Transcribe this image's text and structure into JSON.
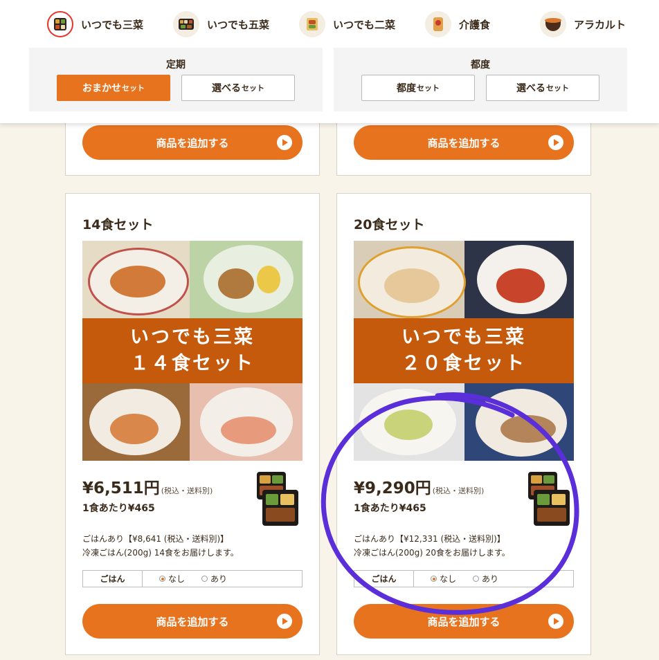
{
  "categories": [
    {
      "label": "いつでも三菜",
      "icon": "three-dish-tray-icon",
      "selected": true
    },
    {
      "label": "いつでも五菜",
      "icon": "five-dish-tray-icon",
      "selected": false
    },
    {
      "label": "いつでも二菜",
      "icon": "two-dish-icon",
      "selected": false
    },
    {
      "label": "介護食",
      "icon": "care-meal-icon",
      "selected": false
    },
    {
      "label": "アラカルト",
      "icon": "bowl-icon",
      "selected": false
    }
  ],
  "panels": {
    "teiki": {
      "title": "定期",
      "btn1_main": "おまかせ",
      "btn1_sub": "セット",
      "btn2_main": "選べる",
      "btn2_sub": "セット"
    },
    "tsudo": {
      "title": "都度",
      "btn1_main": "都度",
      "btn1_sub": "セット",
      "btn2_main": "選べる",
      "btn2_sub": "セット"
    }
  },
  "add_button_label": "商品を追加する",
  "colors": {
    "accent": "#e8731f",
    "band": "#c55a0d",
    "annotation": "#5a2ed8",
    "selected_ring": "#e8332a"
  },
  "cards": [
    {
      "title": "14食セット",
      "banner_line1": "いつでも三菜",
      "banner_line2": "１４食セット",
      "price": "¥6,511円",
      "price_note": "(税込・送料別)",
      "per_meal": "1食あたり¥465",
      "rice_price": "ごはんあり【¥8,641 (税込・送料別)】",
      "rice_desc": "冷凍ごはん(200g) 14食をお届けします。",
      "option_header": "ごはん",
      "option_no": "なし",
      "option_yes": "あり",
      "selected_option": "なし"
    },
    {
      "title": "20食セット",
      "banner_line1": "いつでも三菜",
      "banner_line2": "２０食セット",
      "price": "¥9,290円",
      "price_note": "(税込・送料別)",
      "per_meal": "1食あたり¥465",
      "rice_price": "ごはんあり【¥12,331 (税込・送料別)】",
      "rice_desc": "冷凍ごはん(200g) 20食をお届けします。",
      "option_header": "ごはん",
      "option_no": "なし",
      "option_yes": "あり",
      "selected_option": "なし"
    }
  ]
}
